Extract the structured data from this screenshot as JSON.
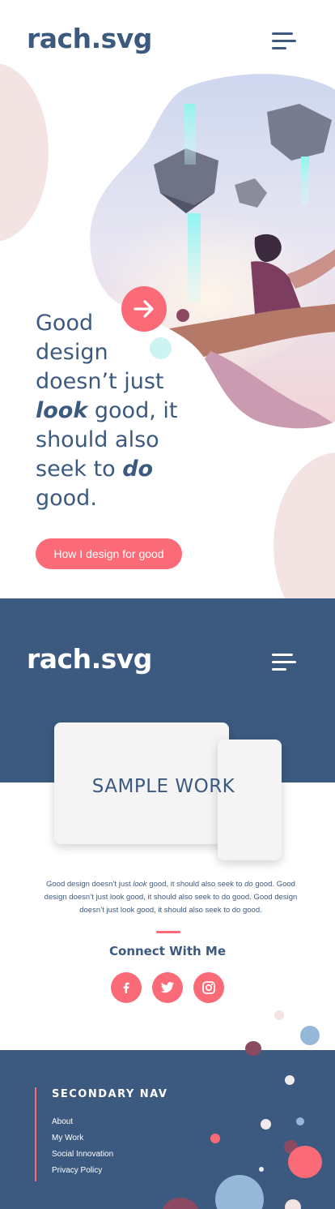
{
  "header": {
    "logo": "rach.svg",
    "menu_icon": "hamburger-menu-icon"
  },
  "hero": {
    "line1": "Good",
    "line2": "design",
    "line3": "doesn’t just",
    "look_word": "look",
    "line4_rest": " good, it",
    "line5": "should also",
    "line6_pre": "seek to ",
    "do_word": "do",
    "line7": "good.",
    "cta_label": "How I design for good",
    "arrow_icon": "arrow-right-icon"
  },
  "work": {
    "logo": "rach.svg",
    "sample_label": "SAMPLE WORK",
    "para_pre": "Good design doesn’t just ",
    "para_look": "look",
    "para_mid": " good, it should also seek to ",
    "para_do": "do",
    "para_rest": " good. Good design doesn’t just look good, it should also seek to do good. Good design doesn’t just look good, it should also seek to do good.",
    "connect_title": "Connect With Me",
    "social": [
      "facebook-icon",
      "twitter-icon",
      "instagram-icon"
    ]
  },
  "footer": {
    "title": "SECONDARY NAV",
    "links": [
      "About",
      "My Work",
      "Social Innovation",
      "Privacy Policy"
    ]
  },
  "colors": {
    "navy": "#3c5a80",
    "coral": "#fb6b77",
    "blush": "#f3e3e3",
    "plum": "#8c4a62",
    "aqua": "#cdf3f3"
  }
}
